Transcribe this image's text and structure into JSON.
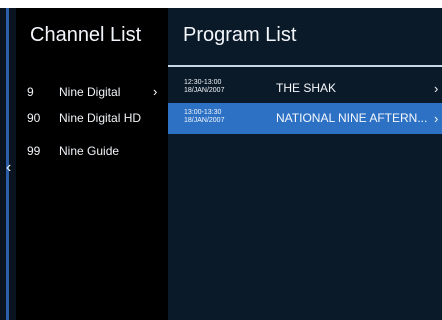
{
  "screen": {
    "left_arrow": "‹",
    "channel_panel_title": "Channel List",
    "program_panel_title": "Program List"
  },
  "channels": [
    {
      "number": "9",
      "name": "Nine Digital",
      "chevron": "›"
    },
    {
      "number": "90",
      "name": "Nine Digital HD"
    },
    {
      "number": "99",
      "name": "Nine Guide"
    }
  ],
  "programs": [
    {
      "time_range": "12:30-13:00",
      "date": "18/JAN/2007",
      "title": "THE SHAK",
      "chevron": "›",
      "selected": false
    },
    {
      "time_range": "13:00-13:30",
      "date": "18/JAN/2007",
      "title": "NATIONAL NINE AFTERN...",
      "chevron": "›",
      "selected": true
    }
  ],
  "colors": {
    "channel_panel_bg": "#000000",
    "program_panel_bg": "#0b1a28",
    "selected_row": "#2d71c5",
    "accent_line": "#c9d6e6"
  }
}
